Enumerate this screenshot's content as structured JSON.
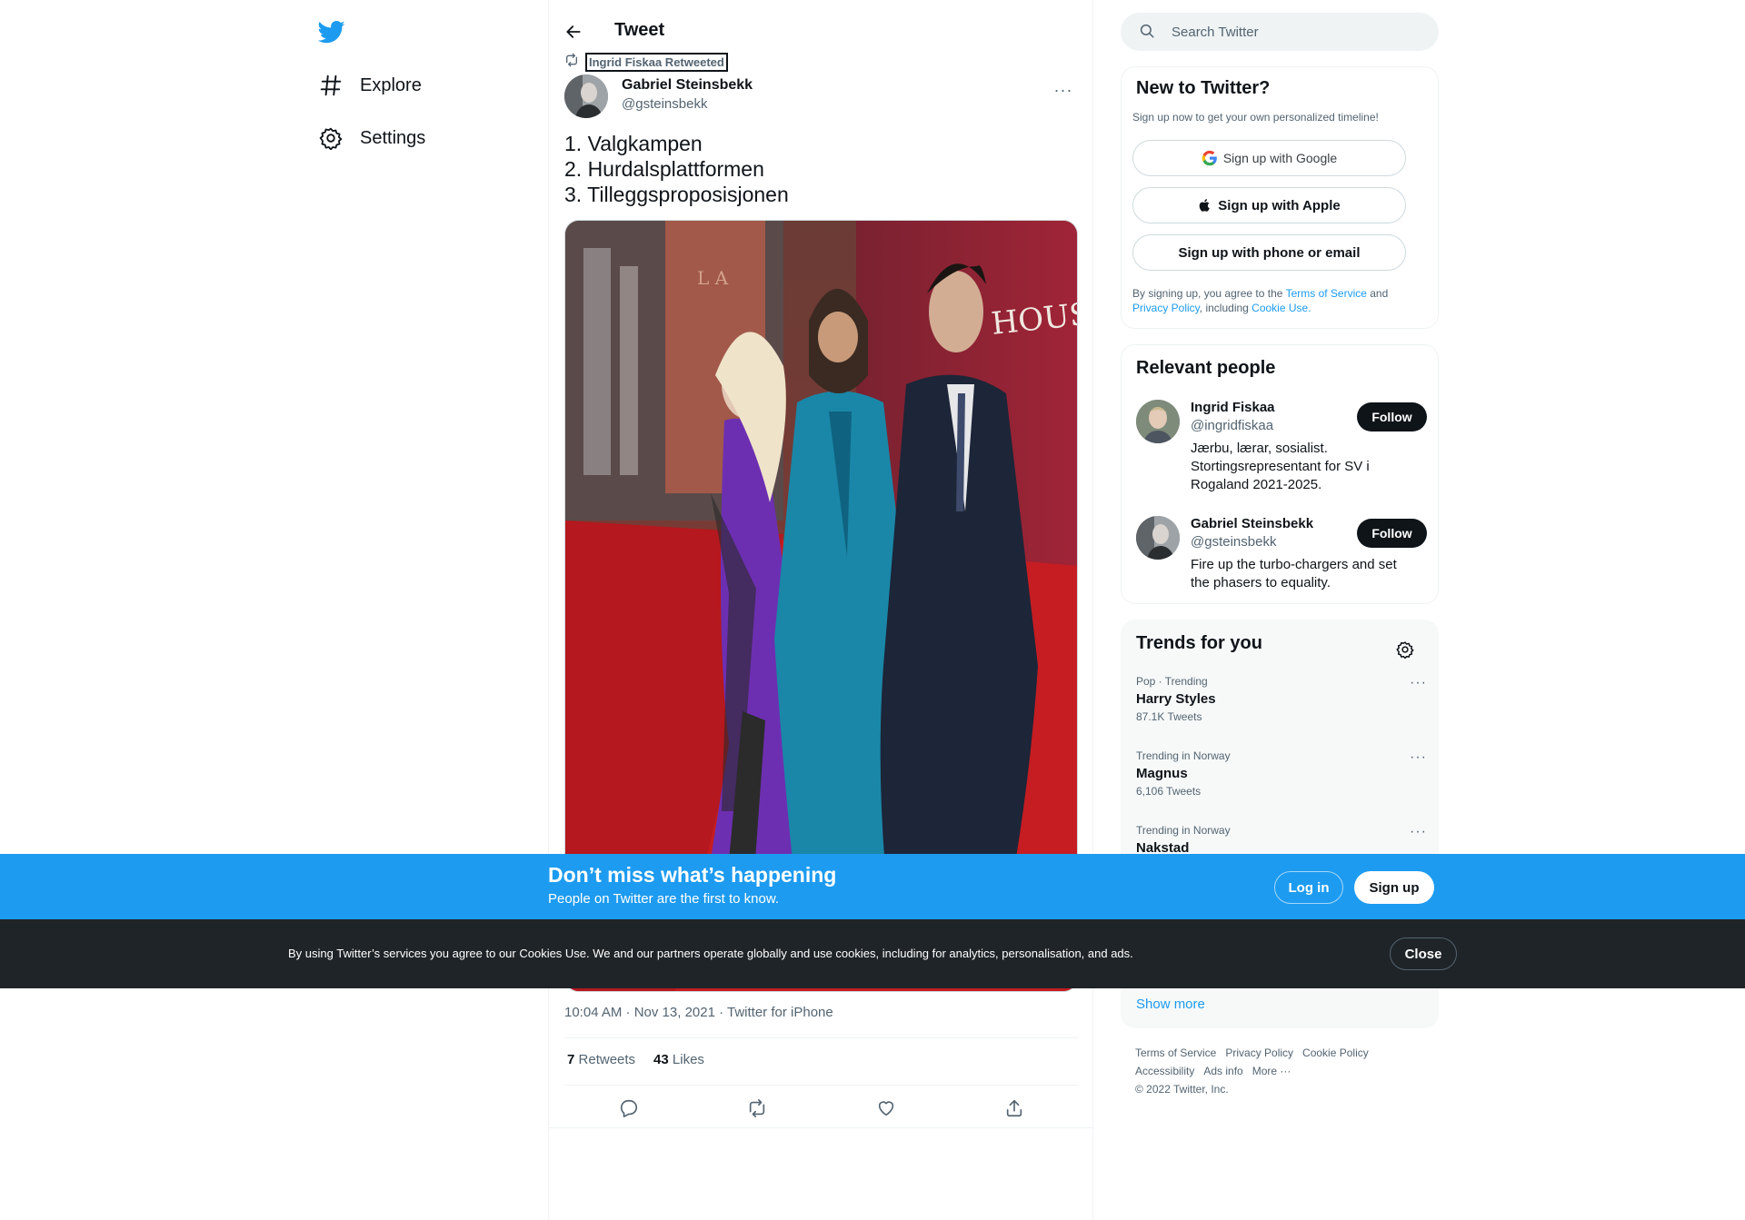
{
  "nav": {
    "logo": "twitter-bird-icon",
    "items": [
      {
        "label": "Explore",
        "icon": "hashtag-icon"
      },
      {
        "label": "Settings",
        "icon": "gear-icon"
      }
    ]
  },
  "header": {
    "title": "Tweet"
  },
  "tweet": {
    "retweeted_by": "Ingrid Fiskaa Retweeted",
    "author_name": "Gabriel Steinsbekk",
    "author_handle": "@gsteinsbekk",
    "lines": [
      "1. Valgkampen",
      "2. Hurdalsplattformen",
      "3. Tilleggsproposisjonen"
    ],
    "meta": "10:04 AM · Nov 13, 2021 · Twitter for iPhone",
    "retweets_count": "7",
    "retweets_label": "Retweets",
    "likes_count": "43",
    "likes_label": "Likes"
  },
  "search": {
    "placeholder": "Search Twitter"
  },
  "signup": {
    "title": "New to Twitter?",
    "subtitle": "Sign up now to get your own personalized timeline!",
    "google": "Sign up with Google",
    "apple": "Sign up with Apple",
    "phone": "Sign up with phone or email",
    "legal_pre": "By signing up, you agree to the ",
    "terms": "Terms of Service",
    "legal_and": " and ",
    "privacy": "Privacy Policy",
    "legal_including": ", including ",
    "cookie": "Cookie Use."
  },
  "people": {
    "title": "Relevant people",
    "list": [
      {
        "name": "Ingrid Fiskaa",
        "handle": "@ingridfiskaa",
        "bio": "Jærbu, lærar, sosialist. Stortingsrepresentant for SV i Rogaland 2021-2025.",
        "follow": "Follow"
      },
      {
        "name": "Gabriel Steinsbekk",
        "handle": "@gsteinsbekk",
        "bio": "Fire up the turbo-chargers and set the phasers to equality.",
        "follow": "Follow"
      }
    ]
  },
  "trends": {
    "title": "Trends for you",
    "list": [
      {
        "context": "Pop · Trending",
        "name": "Harry Styles",
        "count": "87.1K Tweets"
      },
      {
        "context": "Trending in Norway",
        "name": "Magnus",
        "count": "6,106 Tweets"
      },
      {
        "context": "Trending in Norway",
        "name": "Nakstad",
        "count": ""
      }
    ],
    "show_more": "Show more"
  },
  "footer": {
    "links": [
      "Terms of Service",
      "Privacy Policy",
      "Cookie Policy",
      "Accessibility",
      "Ads info",
      "More ···"
    ],
    "copyright": "© 2022 Twitter, Inc."
  },
  "bottom_bar": {
    "title": "Don’t miss what’s happening",
    "subtitle": "People on Twitter are the first to know.",
    "login": "Log in",
    "signup": "Sign up"
  },
  "cookie_bar": {
    "text": "By using Twitter’s services you agree to our Cookies Use. We and our partners operate globally and use cookies, including for analytics, personalisation, and ads.",
    "close": "Close"
  },
  "colors": {
    "accent": "#1d9bf0",
    "text": "#0f1419",
    "muted": "#536471",
    "cookie_bg": "#1f2428"
  }
}
